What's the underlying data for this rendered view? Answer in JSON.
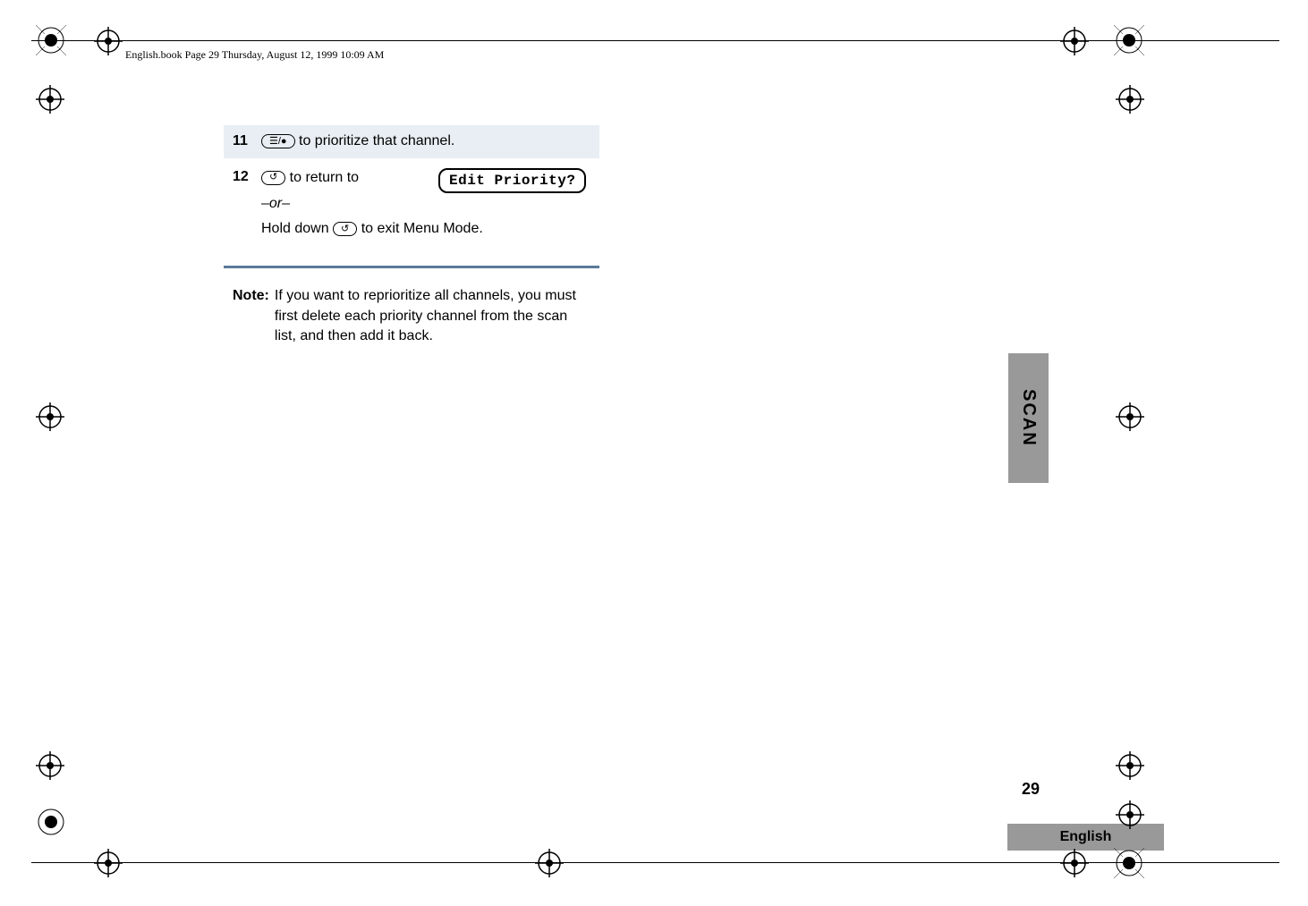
{
  "header": {
    "running_head": "English.book  Page 29  Thursday, August 12, 1999  10:09 AM"
  },
  "steps": {
    "s11": {
      "num": "11",
      "icon_label": "☰/●",
      "text": " to prioritize that channel."
    },
    "s12": {
      "num": "12",
      "icon_label": "↺",
      "text_a": " to return to",
      "or": "–or–",
      "text_b_pre": "Hold down ",
      "text_b_post": " to exit Menu Mode."
    }
  },
  "display": {
    "text": "Edit Priority?"
  },
  "note": {
    "label": "Note:",
    "text": "If you want to reprioritize all channels, you must first delete each priority channel from the scan list, and then add it back."
  },
  "side_tab": "SCAN",
  "page_number": "29",
  "footer_lang": "English"
}
